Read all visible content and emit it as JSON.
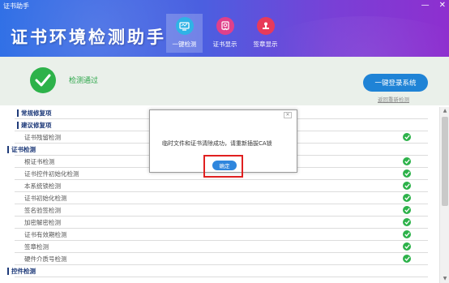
{
  "window": {
    "title": "证书助手",
    "min_label": "—",
    "close_label": "✕"
  },
  "header": {
    "title": "证书环境检测助手"
  },
  "nav": [
    {
      "label": "一键检测",
      "icon": "monitor-icon",
      "color": "#2fb3e6",
      "active": true
    },
    {
      "label": "证书显示",
      "icon": "certificate-icon",
      "color": "#e0408a",
      "active": false
    },
    {
      "label": "签章显示",
      "icon": "seal-icon",
      "color": "#e83a5a",
      "active": false
    }
  ],
  "status": {
    "text": "检测通过",
    "login_button": "一键登录系统",
    "login_link": "返回重新检测"
  },
  "list": [
    {
      "type": "section",
      "label": "常规修复项"
    },
    {
      "type": "section",
      "label": "建议修复项"
    },
    {
      "type": "item",
      "label": "证书残留检测",
      "ok": true
    },
    {
      "type": "section-plain",
      "label": "证书检测"
    },
    {
      "type": "item",
      "label": "根证书检测",
      "ok": true
    },
    {
      "type": "item",
      "label": "证书控件初始化检测",
      "ok": true
    },
    {
      "type": "item",
      "label": "本系统锁检测",
      "ok": true
    },
    {
      "type": "item",
      "label": "证书初始化检测",
      "ok": true
    },
    {
      "type": "item",
      "label": "签名验签检测",
      "ok": true
    },
    {
      "type": "item",
      "label": "加密解密检测",
      "ok": true
    },
    {
      "type": "item",
      "label": "证书有效期检测",
      "ok": true
    },
    {
      "type": "item",
      "label": "签章检测",
      "ok": true
    },
    {
      "type": "item",
      "label": "硬件介质号检测",
      "ok": true
    },
    {
      "type": "section-plain",
      "label": "控件检测"
    }
  ],
  "dialog": {
    "message": "临时文件和证书清除成功，请重新插拔CA锁",
    "ok_button": "确定",
    "close_label": "✕"
  },
  "colors": {
    "success": "#2db24a",
    "primary": "#1f83d6",
    "highlight": "#e02020"
  }
}
